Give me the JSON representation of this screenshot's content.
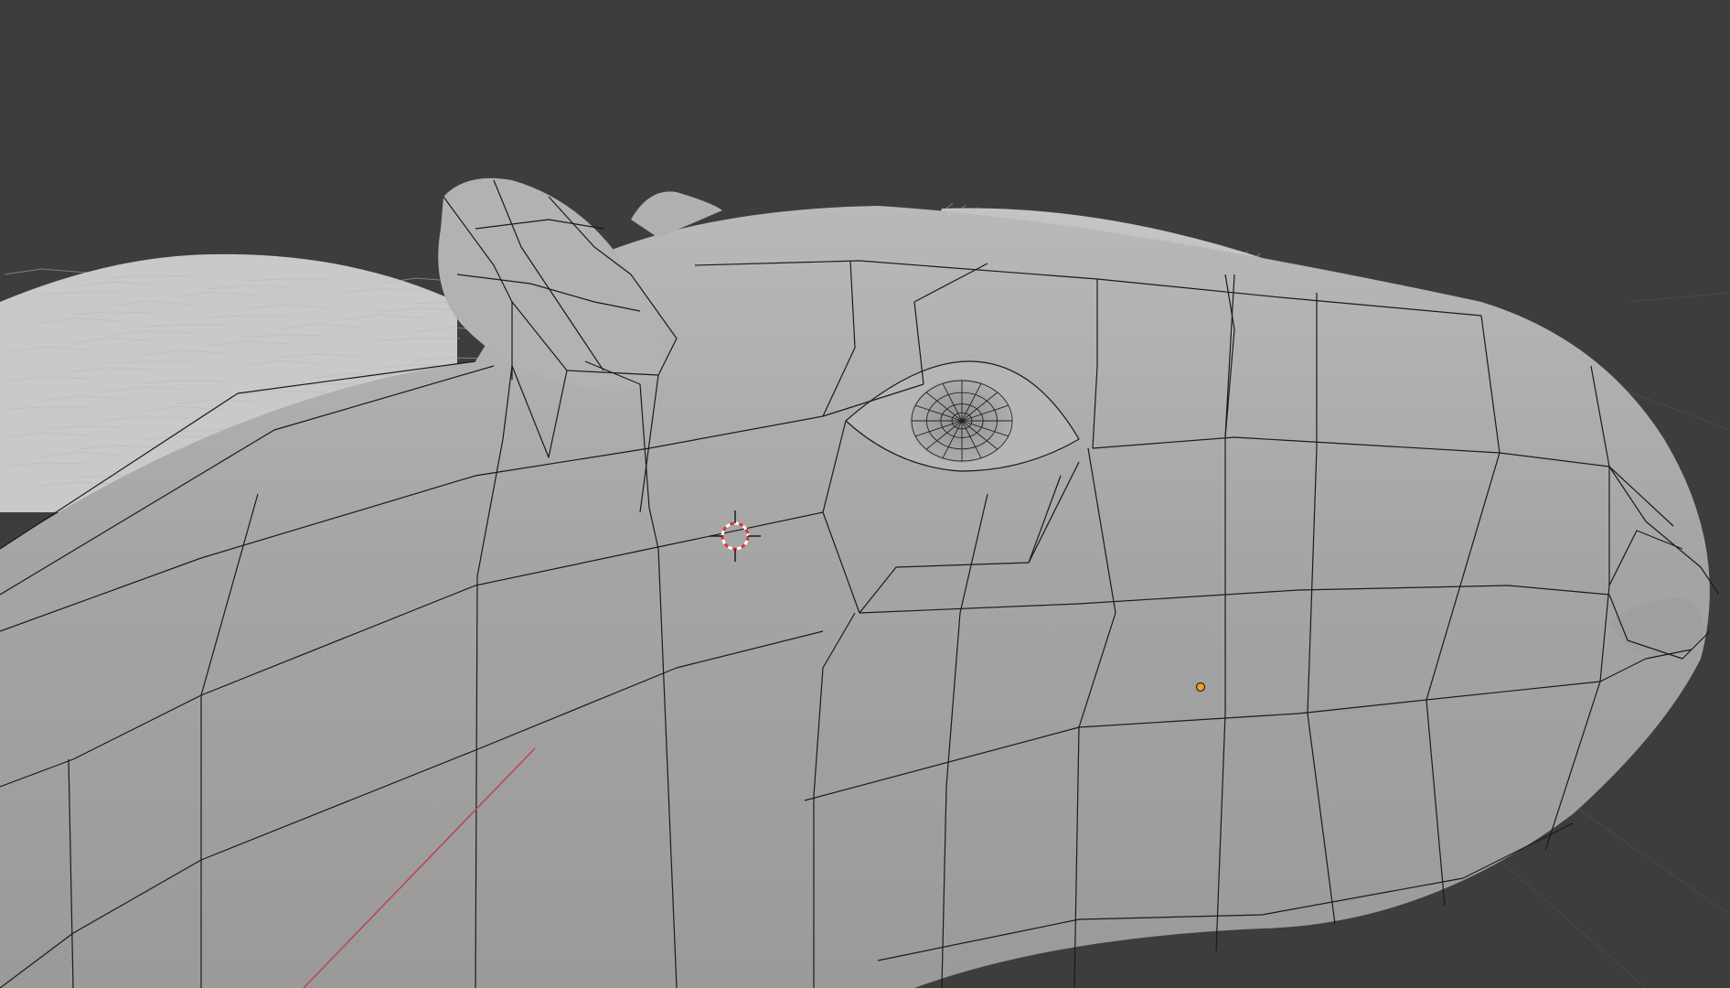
{
  "app": "3D viewport",
  "viewport": {
    "background_color": "#3d3d3d",
    "mesh_color": "#a9a9a9",
    "wire_color": "#1a1a1a",
    "x_axis_color": "#c0474a",
    "cursor_color": "#d83a3a",
    "origin_color": "#f0a020"
  },
  "icons": {
    "cursor": "3d-cursor-icon",
    "origin": "object-origin-icon"
  }
}
